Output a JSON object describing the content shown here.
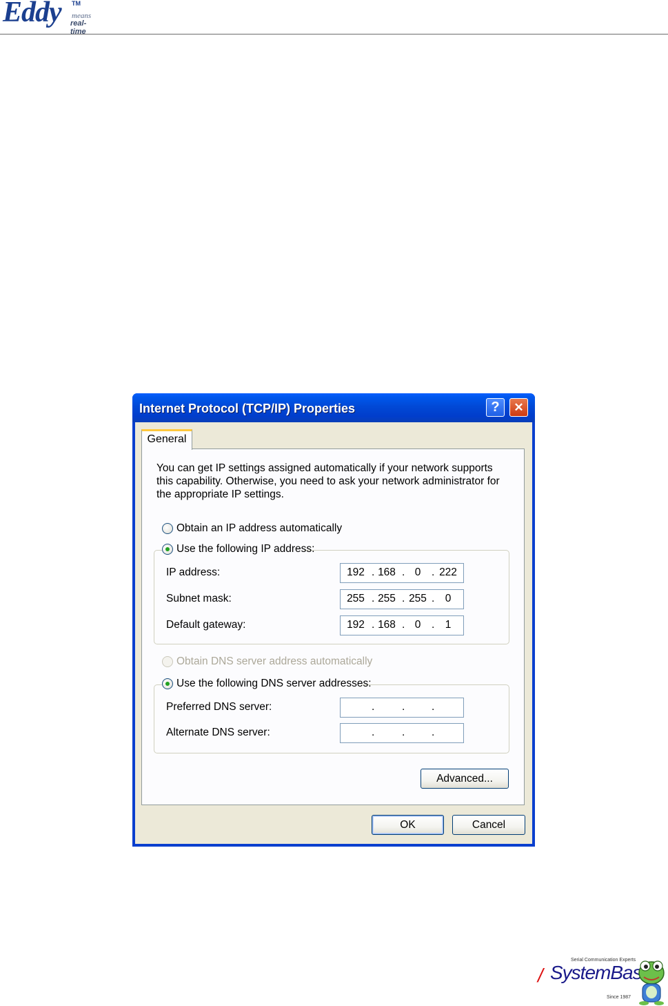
{
  "header": {
    "logo_main": "Eddy",
    "logo_tm": "TM",
    "logo_means": "means",
    "logo_realtime": "real-time"
  },
  "dialog": {
    "title": "Internet Protocol (TCP/IP) Properties",
    "help_label": "?",
    "close_label": "✕",
    "tab_label": "General",
    "description_lines": [
      "You can get IP settings assigned automatically if your network supports",
      "this capability. Otherwise, you need to ask your network administrator for",
      "the appropriate IP settings."
    ],
    "ip_auto_label": "Obtain an IP address automatically",
    "ip_manual_label": "Use the following IP address:",
    "ip_address_label": "IP address:",
    "subnet_mask_label": "Subnet mask:",
    "gateway_label": "Default gateway:",
    "ip_address": [
      "192",
      "168",
      "0",
      "222"
    ],
    "subnet_mask": [
      "255",
      "255",
      "255",
      "0"
    ],
    "gateway": [
      "192",
      "168",
      "0",
      "1"
    ],
    "dns_auto_label": "Obtain DNS server address automatically",
    "dns_manual_label": "Use the following DNS server addresses:",
    "preferred_dns_label": "Preferred DNS server:",
    "alternate_dns_label": "Alternate DNS server:",
    "preferred_dns": [
      "",
      "",
      "",
      ""
    ],
    "alternate_dns": [
      "",
      "",
      "",
      ""
    ],
    "dot": ".",
    "advanced_label": "Advanced...",
    "ok_label": "OK",
    "cancel_label": "Cancel"
  },
  "footer": {
    "tagline": "Serial Communication Experts",
    "brand": "SystemBase",
    "since": "Since 1987"
  },
  "colors": {
    "titlebar": "#0149d6",
    "dialog_face": "#ece9d8",
    "tab_accent": "#ffc83c",
    "radio_dot": "#21a121",
    "brand_blue": "#1b3f8f"
  }
}
